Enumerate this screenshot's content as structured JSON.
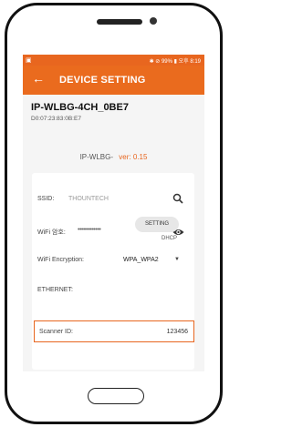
{
  "status_bar": {
    "left_icon": "image-icon",
    "right_text": "✱ ⊘ 99% ▮ 오후 8:19"
  },
  "app_bar": {
    "back_icon": "arrow-left-icon",
    "title": "DEVICE SETTING"
  },
  "device": {
    "name": "IP-WLBG-4CH_0BE7",
    "mac": "D0:07:23:83:0B:E7"
  },
  "version": {
    "model": "IP-WLBG-",
    "version": "ver: 0.15"
  },
  "form": {
    "ssid_label": "SSID:",
    "ssid_value": "THOUNTECH",
    "wifi_pw_label": "WiFi 암호:",
    "wifi_pw_value": "•••••••••••••",
    "encryption_label": "WiFi Encryption:",
    "encryption_value": "WPA_WPA2",
    "ethernet_label": "ETHERNET:",
    "setting_button": "SETTING",
    "dhcp": "DHCP",
    "scanner_label": "Scanner ID:",
    "scanner_value": "123456"
  },
  "colors": {
    "accent": "#ea6b1e",
    "status_bar": "#e8661f"
  }
}
